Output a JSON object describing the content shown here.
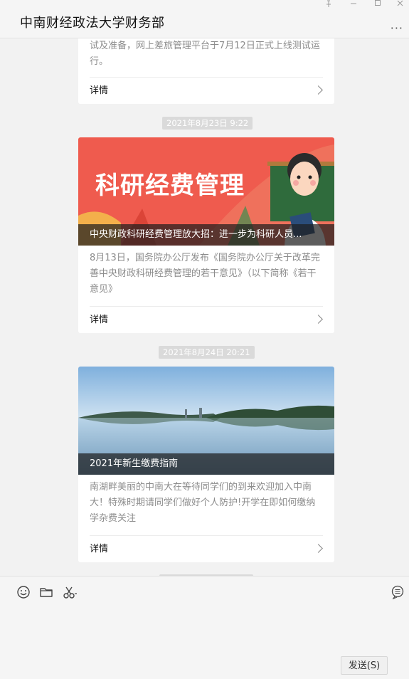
{
  "window": {
    "title": "中南财经政法大学财务部",
    "more_label": "···"
  },
  "messages": [
    {
      "desc": "试及准备，网上差旅管理平台于7月12日正式上线测试运行。",
      "detail_label": "详情"
    },
    {
      "timestamp": "2021年8月23日 9:22",
      "cover_title": "科研经费管理",
      "caption": "中央财政科研经费管理放大招：进一步为科研人员...",
      "desc": "8月13日，国务院办公厅发布《国务院办公厅关于改革完善中央财政科研经费管理的若干意见》（以下简称《若干意见》",
      "detail_label": "详情"
    },
    {
      "timestamp": "2021年8月24日 20:21",
      "caption": "2021年新生缴费指南",
      "desc": "南湖畔美丽的中南大在等待同学们的到来欢迎加入中南大！特殊时期请同学们做好个人防护!开学在即如何缴纳学杂费关注",
      "detail_label": "详情"
    }
  ],
  "input": {
    "send_label": "发送(S)",
    "icons": [
      "emoji-icon",
      "folder-icon",
      "scissors-icon",
      "chat-history-icon"
    ]
  },
  "colors": {
    "banner_red": "#ef5b4e",
    "board_green": "#2f6b3c"
  }
}
